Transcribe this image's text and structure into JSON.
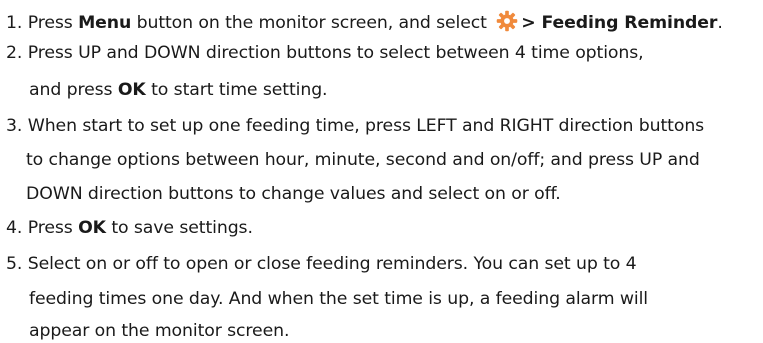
{
  "steps": [
    {
      "number": "1.",
      "pre": "Press ",
      "bold_1": "Menu",
      "mid": " button on the monitor screen, and select ",
      "icon": "gear-icon",
      "bold_2": "> Feeding Reminder",
      "post": "."
    },
    {
      "number": "2.",
      "line_1": "Press UP and DOWN direction buttons to select between 4 time options,",
      "line_2_pre": "and press ",
      "line_2_bold": "OK",
      "line_2_post": " to start time setting."
    },
    {
      "number": "3.",
      "line_1": "When start to set up one feeding time, press LEFT and RIGHT direction buttons",
      "line_2": "to change options between hour, minute, second and on/off; and press UP and",
      "line_3": "DOWN direction buttons to change values and select on or off."
    },
    {
      "number": "4.",
      "pre": "Press ",
      "bold": "OK",
      "post": " to save settings."
    },
    {
      "number": "5.",
      "line_1": "Select on or off to open or close feeding reminders. You can set up to 4",
      "line_2": "feeding times one day. And when the set time is up, a feeding alarm will",
      "line_3": "appear on the monitor screen."
    }
  ],
  "colors": {
    "text": "#1a1a1a",
    "gear_icon": "#f08a3c"
  }
}
